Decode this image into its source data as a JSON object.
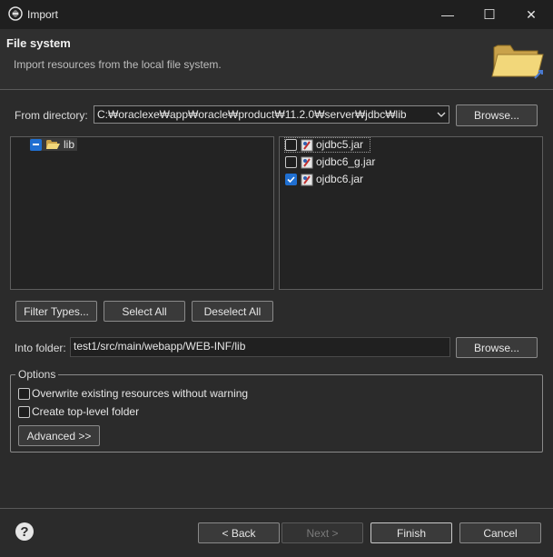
{
  "window": {
    "title": "Import",
    "minimize_glyph": "—",
    "maximize_glyph": "☐",
    "close_glyph": "✕"
  },
  "header": {
    "title": "File system",
    "description": "Import resources from the local file system."
  },
  "from_directory": {
    "label": "From directory:",
    "value": "C:₩oraclexe₩app₩oracle₩product₩11.2.0₩server₩jdbc₩lib",
    "browse_label": "Browse..."
  },
  "tree": {
    "items": [
      {
        "label": "lib",
        "state": "partial"
      }
    ]
  },
  "files": {
    "items": [
      {
        "label": "ojdbc5.jar",
        "checked": false
      },
      {
        "label": "ojdbc6_g.jar",
        "checked": false
      },
      {
        "label": "ojdbc6.jar",
        "checked": true
      }
    ]
  },
  "selection_buttons": {
    "filter_types": "Filter Types...",
    "select_all": "Select All",
    "deselect_all": "Deselect All"
  },
  "into_folder": {
    "label": "Into folder:",
    "value": "test1/src/main/webapp/WEB-INF/lib",
    "browse_label": "Browse..."
  },
  "options": {
    "legend": "Options",
    "overwrite_label": "Overwrite existing resources without warning",
    "overwrite_checked": false,
    "toplevel_label": "Create top-level folder",
    "toplevel_checked": false,
    "advanced_label": "Advanced >>"
  },
  "footer": {
    "back_label": "< Back",
    "next_label": "Next >",
    "finish_label": "Finish",
    "cancel_label": "Cancel"
  },
  "colors": {
    "background": "#2b2b2b",
    "accent": "#1f6fd1",
    "title_bar": "#1f1f1f"
  }
}
